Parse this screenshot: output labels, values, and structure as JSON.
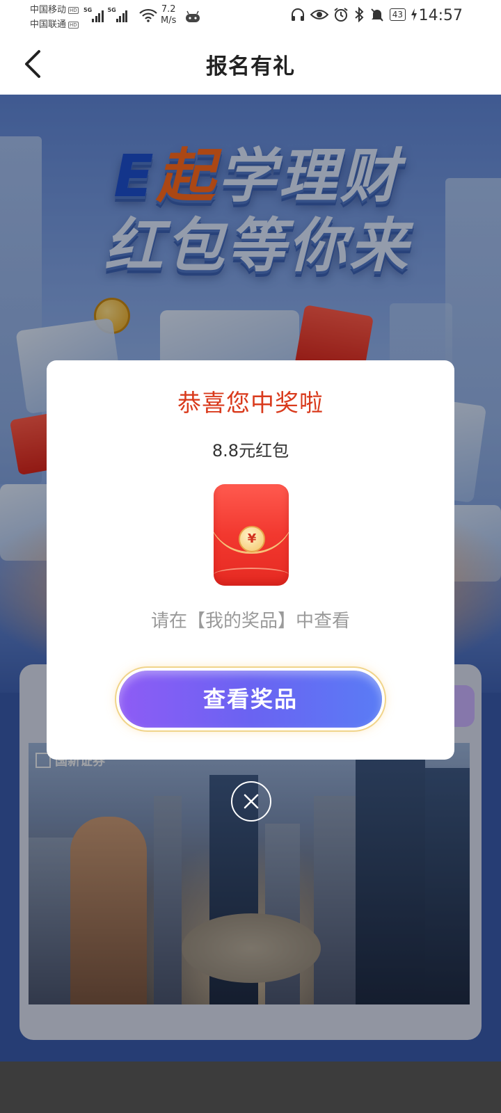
{
  "status_bar": {
    "carrier_1": "中国移动",
    "carrier_2": "中国联通",
    "hd_tag": "HD",
    "network_1": "5G",
    "network_2": "5G",
    "speed_value": "7.2",
    "speed_unit": "M/s",
    "battery": "43",
    "time": "14:57"
  },
  "nav": {
    "title": "报名有礼",
    "back_icon": "chevron-left-icon"
  },
  "banner": {
    "line1_e": "E",
    "line1_qi": "起",
    "line1_rest": "学理财",
    "line2": "红包等你来",
    "photo_logo": "国新证券"
  },
  "modal": {
    "title": "恭喜您中奖啦",
    "prize": "8.8元红包",
    "packet_symbol": "¥",
    "hint": "请在【我的奖品】中查看",
    "button_label": "查看奖品",
    "close_icon": "close-icon"
  },
  "colors": {
    "title_red": "#d93a1c",
    "button_start": "#8e5cf5",
    "button_end": "#5a7cf5",
    "packet_red": "#f2382f"
  }
}
